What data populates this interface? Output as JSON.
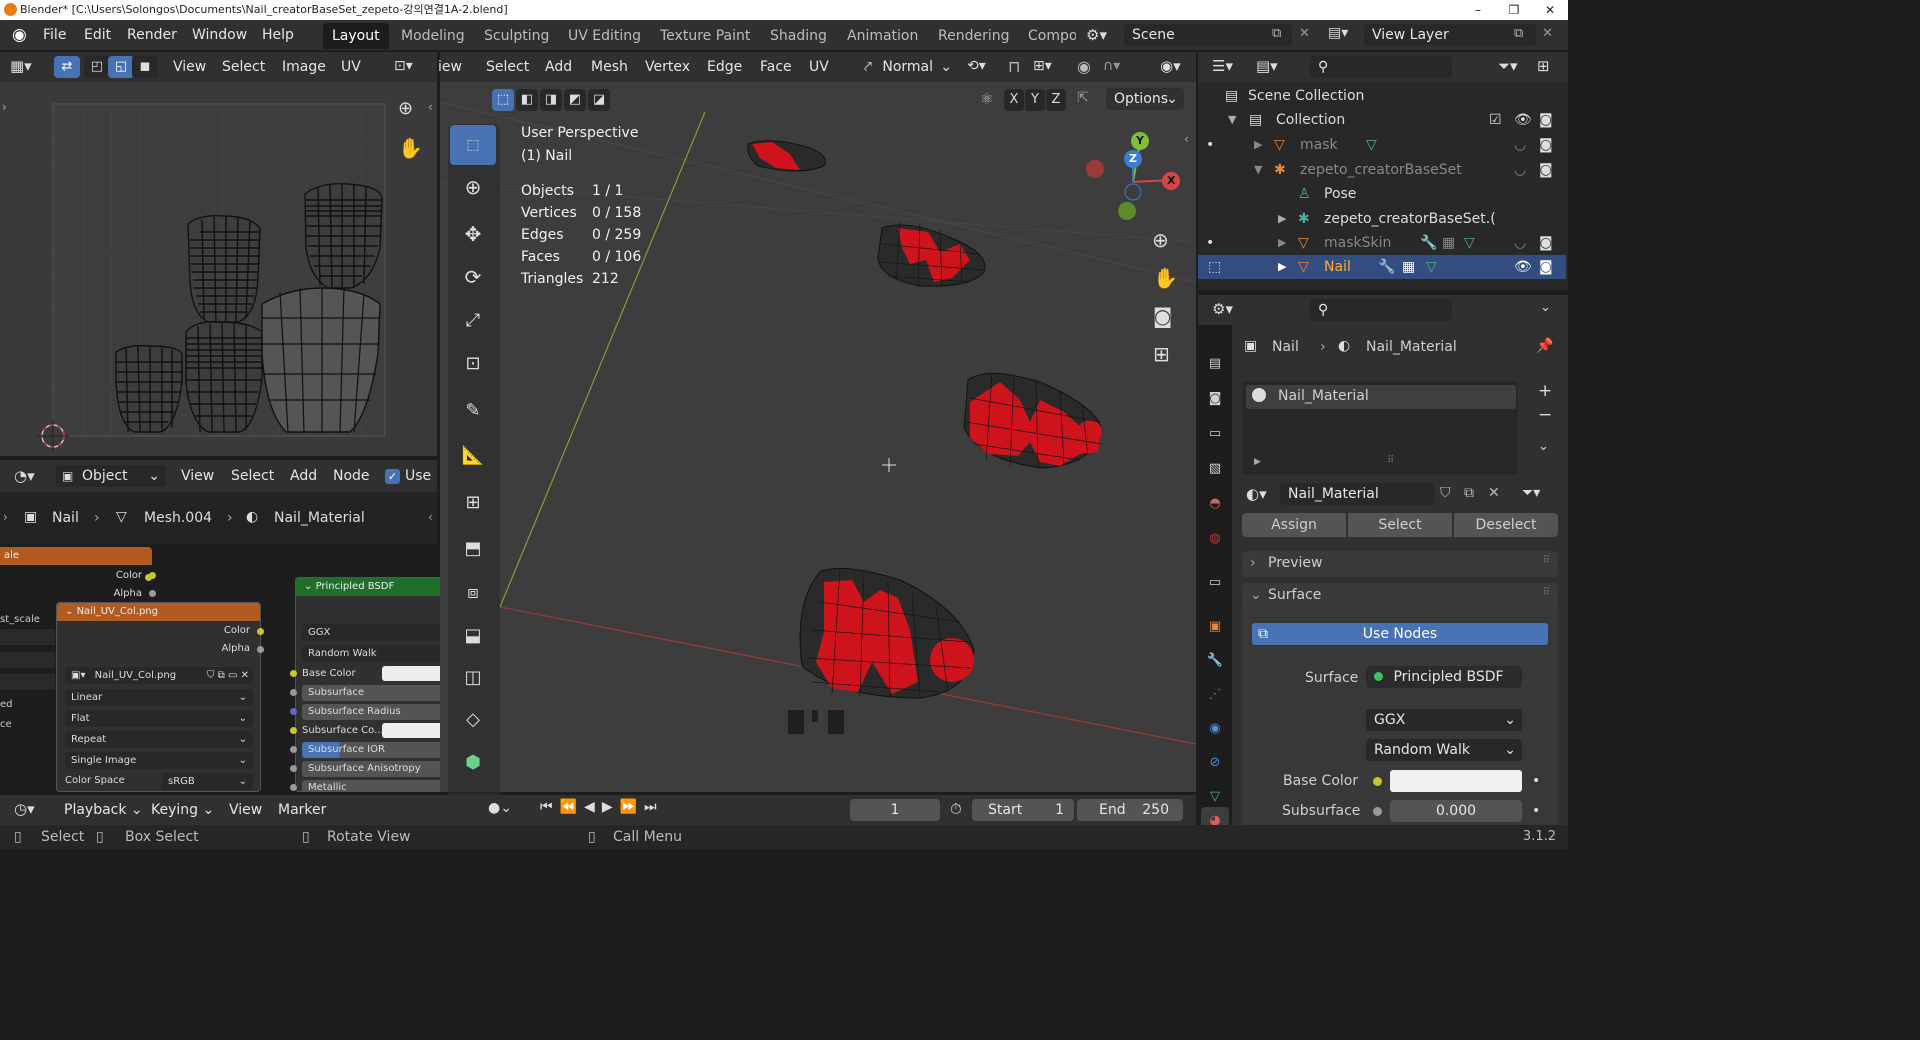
{
  "window": {
    "title": "Blender* [C:\\Users\\Solongos\\Documents\\Nail_creatorBaseSet_zepeto-강의연결1A-2.blend]"
  },
  "menu": {
    "items": [
      "File",
      "Edit",
      "Render",
      "Window",
      "Help"
    ]
  },
  "workspaces": [
    "Layout",
    "Modeling",
    "Sculpting",
    "UV Editing",
    "Texture Paint",
    "Shading",
    "Animation",
    "Rendering",
    "Compo"
  ],
  "scene": {
    "name": "Scene",
    "view_layer": "View Layer"
  },
  "uv_editor": {
    "menus": [
      "View",
      "Select",
      "Image",
      "UV"
    ]
  },
  "viewport": {
    "menus": [
      "iew",
      "Select",
      "Add",
      "Mesh",
      "Vertex",
      "Edge",
      "Face",
      "UV"
    ],
    "orientation": "Normal",
    "options_label": "Options",
    "axes": [
      "X",
      "Y",
      "Z"
    ],
    "title": "User Perspective",
    "subtitle": "(1) Nail",
    "stats": [
      {
        "label": "Objects",
        "value": "1 / 1"
      },
      {
        "label": "Vertices",
        "value": "0 / 158"
      },
      {
        "label": "Edges",
        "value": "0 / 259"
      },
      {
        "label": "Faces",
        "value": "0 / 106"
      },
      {
        "label": "Triangles",
        "value": "212"
      }
    ]
  },
  "node_editor": {
    "mode": "Object",
    "menus": [
      "View",
      "Select",
      "Add",
      "Node"
    ],
    "use_nodes_label": "Use N",
    "breadcrumb": [
      "Nail",
      "Mesh.004",
      "Nail_Material"
    ],
    "partial_node": {
      "title": "ale",
      "out_color": "Color",
      "out_alpha": "Alpha",
      "left_label_1": "st_scale",
      "left_label_2": "ed",
      "left_label_3": "ce"
    },
    "image_node": {
      "title": "Nail_UV_Col.png",
      "out_color": "Color",
      "out_alpha": "Alpha",
      "image_name": "Nail_UV_Col.png",
      "interpolation": "Linear",
      "projection": "Flat",
      "extension": "Repeat",
      "source": "Single Image",
      "color_space_label": "Color Space",
      "color_space": "sRGB"
    },
    "bsdf_node": {
      "title": "Principled BSDF",
      "distribution": "GGX",
      "subsurface_method": "Random Walk",
      "inputs": [
        "Base Color",
        "Subsurface",
        "Subsurface Radius",
        "Subsurface Co...",
        "Subsurface IOR",
        "Subsurface Anisotropy",
        "Metallic"
      ]
    }
  },
  "outliner": {
    "rows": [
      {
        "label": "Scene Collection"
      },
      {
        "label": "Collection"
      },
      {
        "label": "mask"
      },
      {
        "label": "zepeto_creatorBaseSet"
      },
      {
        "label": "Pose"
      },
      {
        "label": "zepeto_creatorBaseSet.("
      },
      {
        "label": "maskSkin"
      },
      {
        "label": "Nail"
      }
    ]
  },
  "properties": {
    "breadcrumb_object": "Nail",
    "breadcrumb_material": "Nail_Material",
    "slot": "Nail_Material",
    "material_name": "Nail_Material",
    "assign": "Assign",
    "select": "Select",
    "deselect": "Deselect",
    "preview": "Preview",
    "surface_section": "Surface",
    "use_nodes": "Use Nodes",
    "surface_label": "Surface",
    "surface_value": "Principled BSDF",
    "distribution": "GGX",
    "subsurface_method": "Random Walk",
    "base_color_label": "Base Color",
    "subsurface_label": "Subsurface",
    "subsurface_value": "0.000"
  },
  "timeline": {
    "menus": [
      "Playback",
      "Keying",
      "View",
      "Marker"
    ],
    "current_frame": "1",
    "start_label": "Start",
    "start_value": "1",
    "end_label": "End",
    "end_value": "250"
  },
  "statusbar": {
    "select": "Select",
    "box_select": "Box Select",
    "rotate_view": "Rotate View",
    "call_menu": "Call Menu",
    "version": "3.1.2"
  },
  "colors": {
    "accent": "#4772b3",
    "nail_red": "#d0141e",
    "image_header": "#b35a21",
    "shader_header": "#1f6f2a"
  }
}
